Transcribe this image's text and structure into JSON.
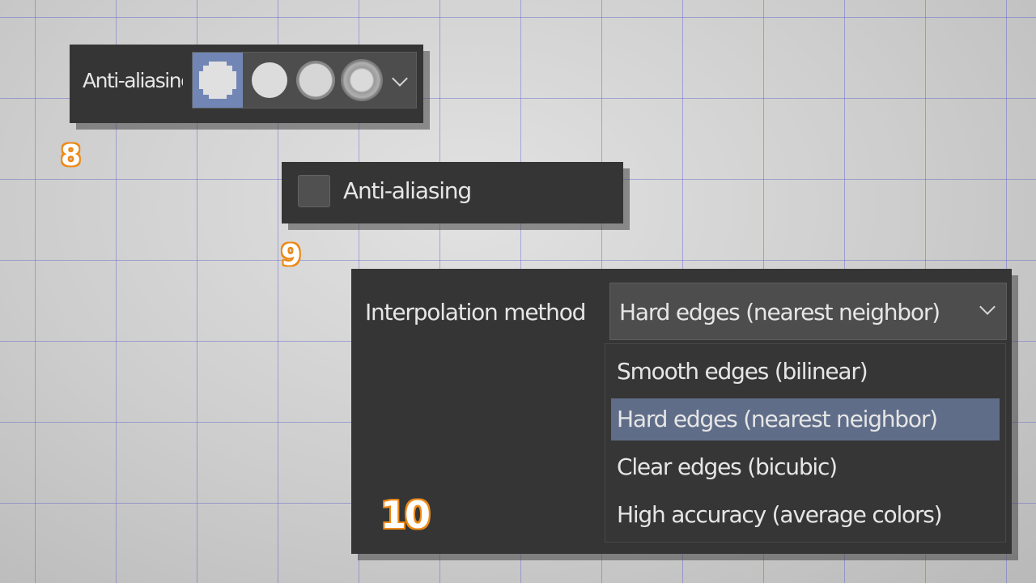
{
  "panel8": {
    "tag": "8",
    "label": "Anti-aliasing",
    "options": [
      {
        "name": "none",
        "icon": "pixel-cross-icon",
        "selected": true
      },
      {
        "name": "weak",
        "icon": "solid-circle-icon",
        "selected": false
      },
      {
        "name": "medium",
        "icon": "soft-circle-icon",
        "selected": false
      },
      {
        "name": "strong",
        "icon": "softer-circle-icon",
        "selected": false
      }
    ],
    "dropdown_icon": "chevron-down-icon"
  },
  "panel9": {
    "tag": "9",
    "checkbox_label": "Anti-aliasing",
    "checked": false
  },
  "panel10": {
    "tag": "10",
    "label": "Interpolation method",
    "selected_value": "Hard edges (nearest neighbor)",
    "options": [
      "Smooth edges (bilinear)",
      "Hard edges (nearest neighbor)",
      "Clear edges (bicubic)",
      "High accuracy (average colors)"
    ],
    "highlighted_index": 1
  },
  "colors": {
    "panel_bg": "#353535",
    "accent_selected": "#7186b5",
    "list_highlight": "#5f6d88",
    "tag_orange": "#ec8a19",
    "grid_lines": "#5f5fcd"
  }
}
